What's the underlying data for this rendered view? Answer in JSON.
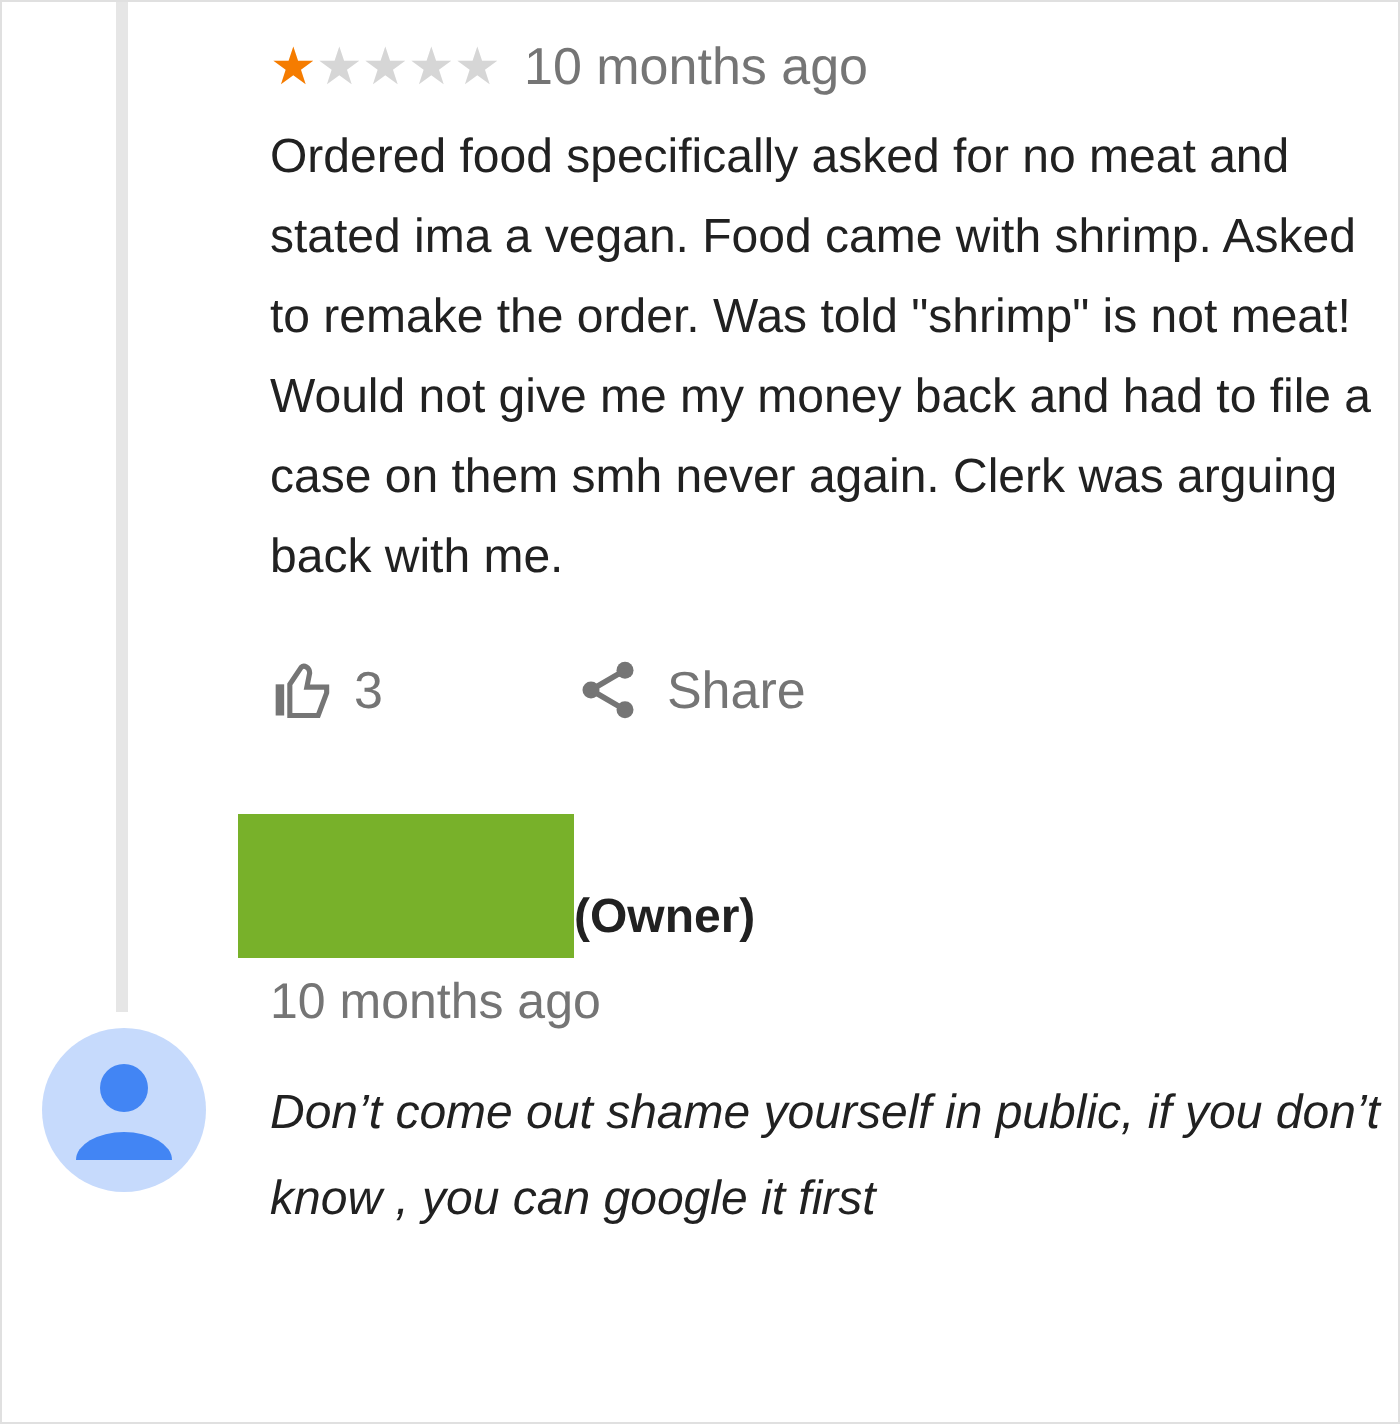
{
  "review": {
    "stars": 1,
    "time": "10 months ago",
    "text": "Ordered food specifically asked for no meat and stated ima a vegan. Food came with shrimp. Asked to remake the order. Was told \"shrimp\" is not meat! Would not give me my money back and had to file a case on them smh never again. Clerk was arguing back with me.",
    "likes": "3",
    "share": "Share"
  },
  "reply": {
    "role": "(Owner)",
    "time": "10 months ago",
    "text": "Don’t come out shame yourself in public, if you don’t know , you can google it first"
  }
}
